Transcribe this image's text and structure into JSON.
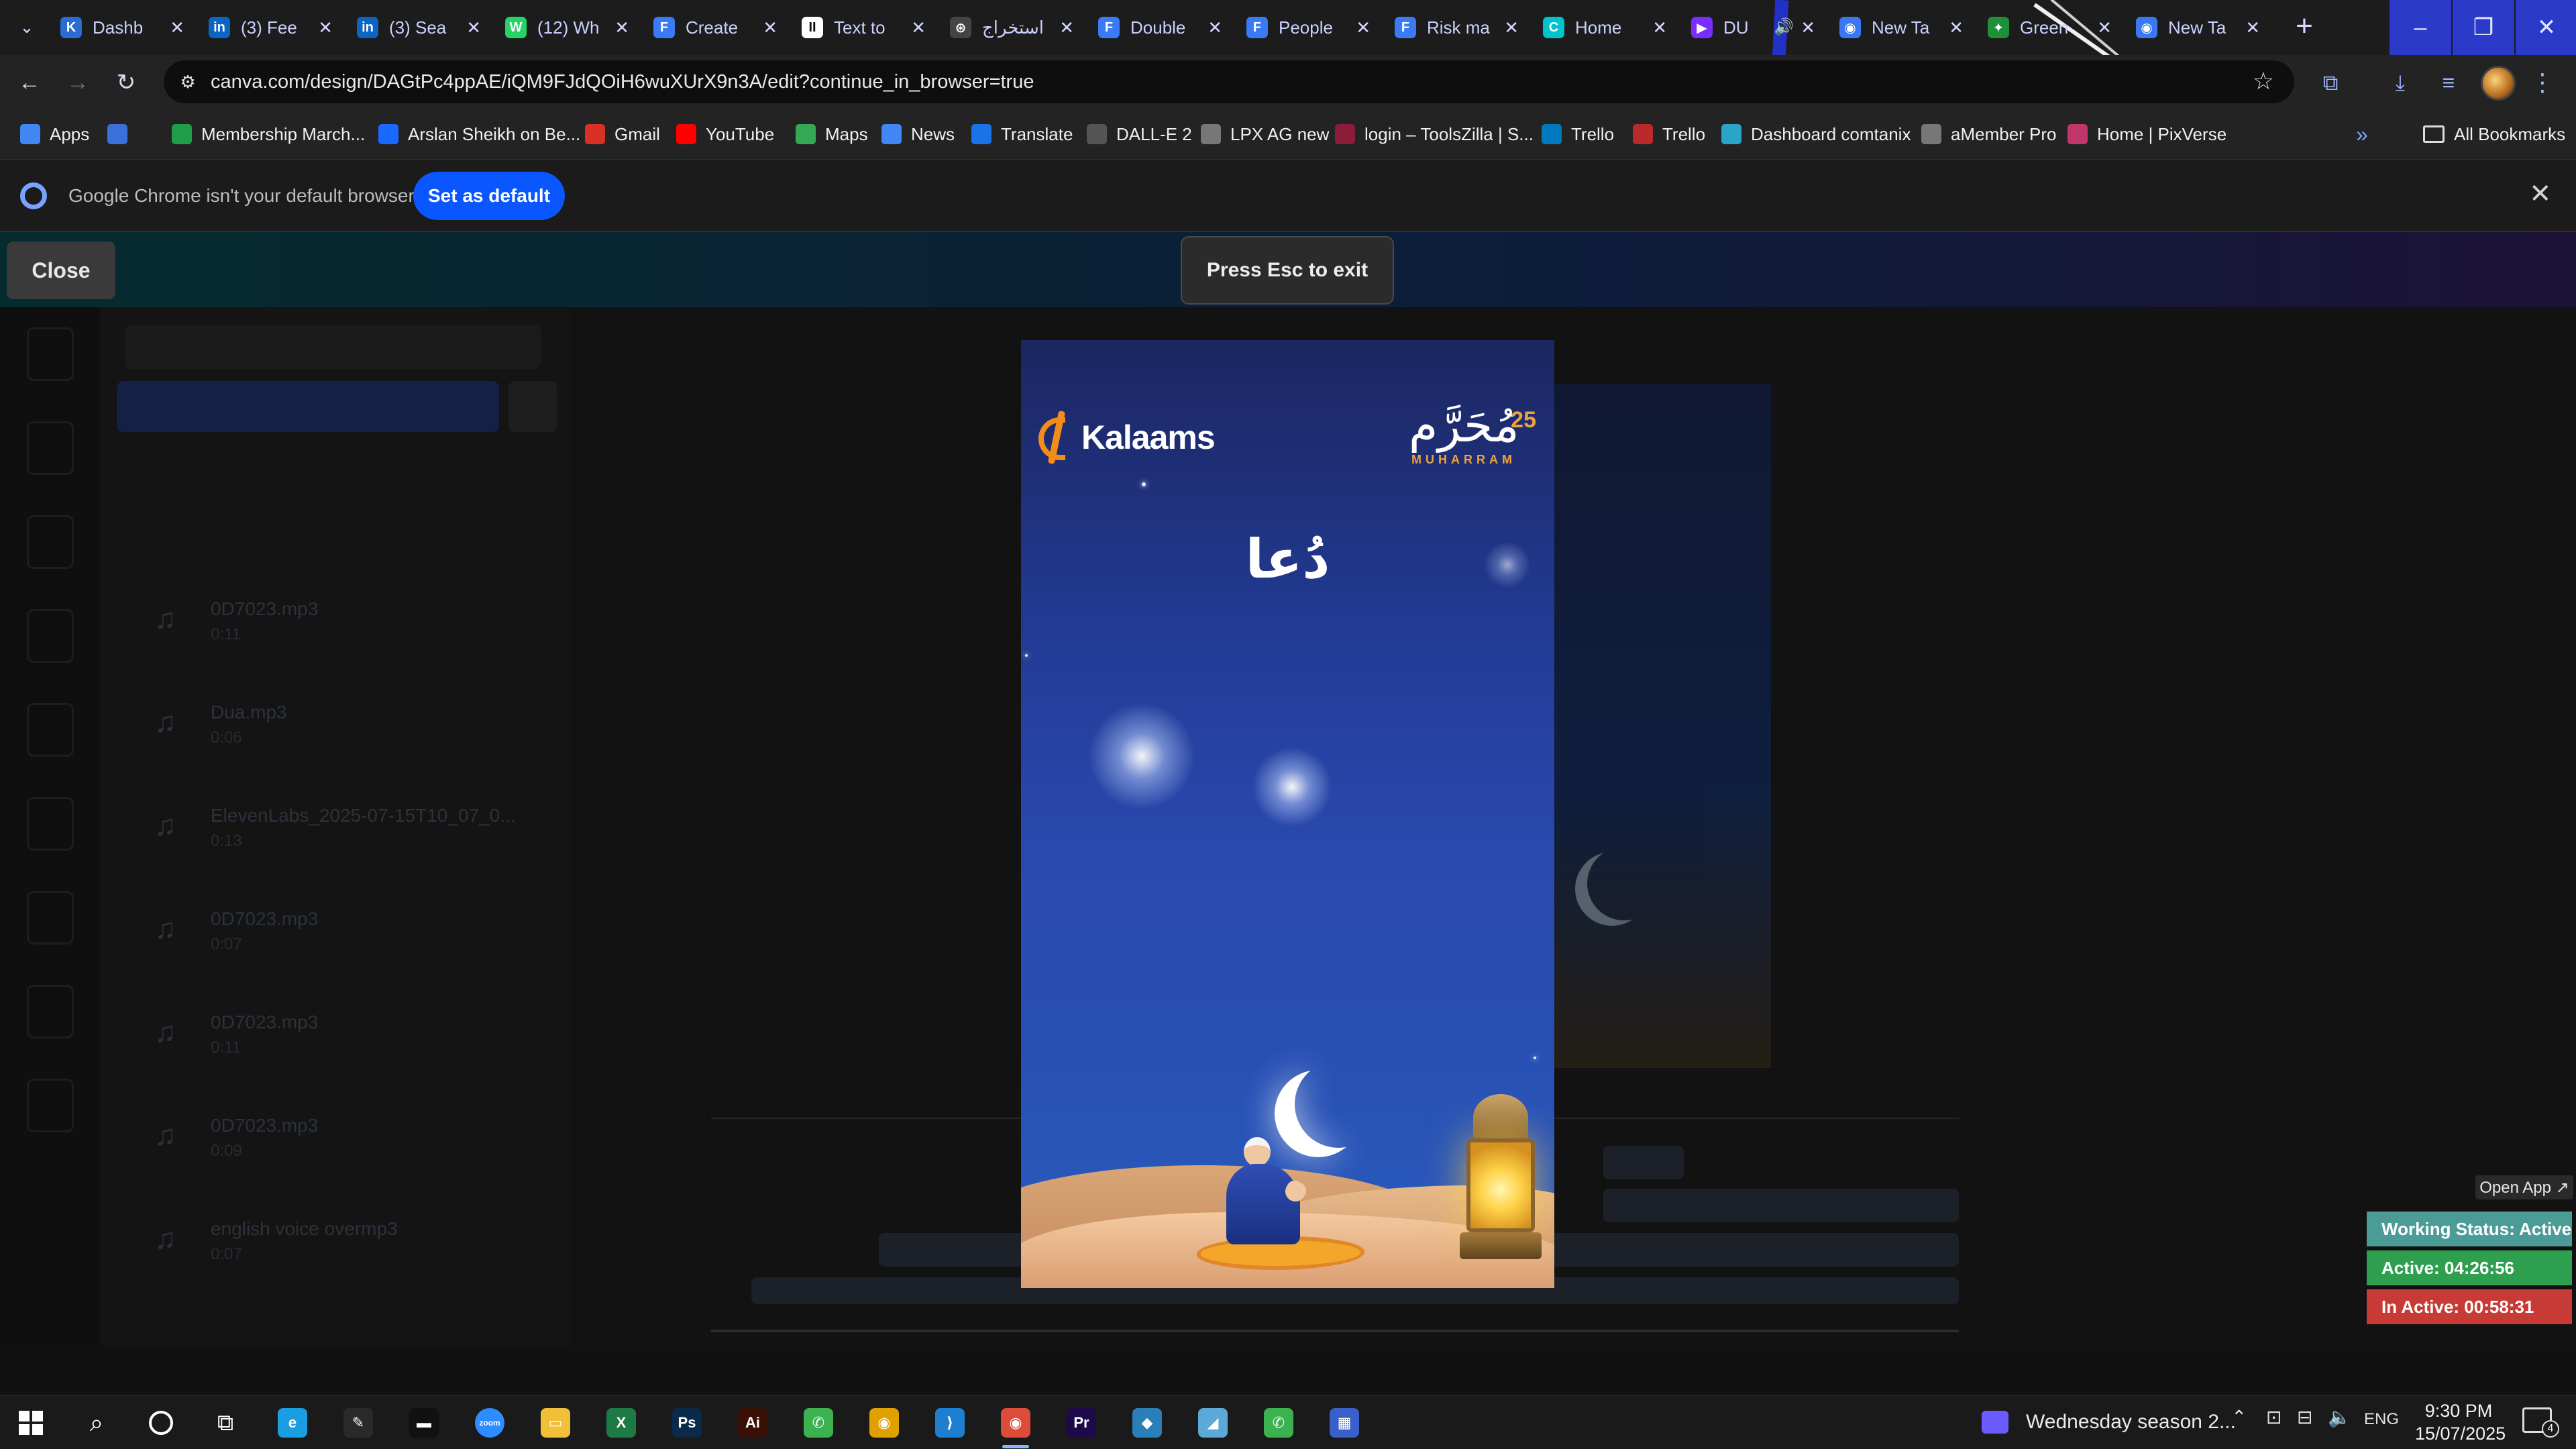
{
  "browser": {
    "tabs": [
      {
        "title": "Dashb",
        "icon": "kalaams-favicon",
        "color": "#2a6bd4",
        "glyph": "K"
      },
      {
        "title": "(3) Fee",
        "icon": "linkedin-icon",
        "color": "#0a66c2",
        "glyph": "in"
      },
      {
        "title": "(3) Sea",
        "icon": "linkedin-icon",
        "color": "#0a66c2",
        "glyph": "in"
      },
      {
        "title": "(12) Wh",
        "icon": "whatsapp-icon",
        "color": "#25d366",
        "glyph": "W"
      },
      {
        "title": "Create",
        "icon": "forms-icon",
        "color": "#3a7bf5",
        "glyph": "F"
      },
      {
        "title": "Text to",
        "icon": "textto-icon",
        "color": "#ffffff",
        "glyph": "II"
      },
      {
        "title": "استخراج",
        "icon": "openai-icon",
        "color": "#444444",
        "glyph": "⊛"
      },
      {
        "title": "Double",
        "icon": "forms-icon",
        "color": "#3a7bf5",
        "glyph": "F"
      },
      {
        "title": "People",
        "icon": "forms-icon",
        "color": "#3a7bf5",
        "glyph": "F"
      },
      {
        "title": "Risk ma",
        "icon": "forms-icon",
        "color": "#3a7bf5",
        "glyph": "F"
      },
      {
        "title": "Home",
        "icon": "canva-icon",
        "color": "#00c4cc",
        "glyph": "C"
      },
      {
        "title": "DU",
        "icon": "video-icon",
        "color": "#7b2cff",
        "glyph": "▶",
        "audio": true
      },
      {
        "title": "New Ta",
        "icon": "chrome-icon",
        "color": "#3a78f2",
        "glyph": "◉"
      },
      {
        "title": "Green",
        "icon": "palm-icon",
        "color": "#1f8f3a",
        "glyph": "✦"
      },
      {
        "title": "New Ta",
        "icon": "chrome-icon",
        "color": "#3a78f2",
        "glyph": "◉"
      }
    ],
    "url": "canva.com/design/DAGtPc4ppAE/iQM9FJdQOiH6wuXUrX9n3A/edit?continue_in_browser=true",
    "bookmarks": [
      {
        "label": "Apps",
        "icon": "apps-grid-icon",
        "color": "#4285f4"
      },
      {
        "label": "",
        "icon": "grid-icon",
        "color": "#3b6fd9"
      },
      {
        "label": "Membership March...",
        "icon": "green-bookmark-icon",
        "color": "#1e9e4a"
      },
      {
        "label": "Arslan Sheikh on Be...",
        "icon": "behance-icon",
        "color": "#1769ff"
      },
      {
        "label": "Gmail",
        "icon": "gmail-icon",
        "color": "#d93025"
      },
      {
        "label": "YouTube",
        "icon": "youtube-icon",
        "color": "#ff0000"
      },
      {
        "label": "Maps",
        "icon": "maps-icon",
        "color": "#34a853"
      },
      {
        "label": "News",
        "icon": "news-icon",
        "color": "#4285f4"
      },
      {
        "label": "Translate",
        "icon": "translate-icon",
        "color": "#1a73e8"
      },
      {
        "label": "DALL-E 2",
        "icon": "openai-icon",
        "color": "#555555"
      },
      {
        "label": "LPX AG new",
        "icon": "globe-icon",
        "color": "#777777"
      },
      {
        "label": "login – ToolsZilla | S...",
        "icon": "toolszilla-icon",
        "color": "#8b1d3a"
      },
      {
        "label": "Trello",
        "icon": "trello-icon",
        "color": "#0079bf"
      },
      {
        "label": "Trello",
        "icon": "trello-icon",
        "color": "#bb2a2a"
      },
      {
        "label": "Dashboard comtanix",
        "icon": "comtanix-icon",
        "color": "#2aa5c7"
      },
      {
        "label": "aMember Pro",
        "icon": "globe-icon",
        "color": "#777777"
      },
      {
        "label": "Home | PixVerse",
        "icon": "pixverse-icon",
        "color": "#c1366a"
      }
    ],
    "all_bookmarks": "All Bookmarks"
  },
  "infobar": {
    "message": "Google Chrome isn't your default browser",
    "button": "Set as default"
  },
  "editor": {
    "close": "Close",
    "esc_toast": "Press Esc to exit",
    "audio_items": [
      {
        "name": "0D7023.mp3",
        "duration": "0:11"
      },
      {
        "name": "Dua.mp3",
        "duration": "0:06"
      },
      {
        "name": "ElevenLabs_2025-07-15T10_07_0...",
        "duration": "0:13"
      },
      {
        "name": "0D7023.mp3",
        "duration": "0:07"
      },
      {
        "name": "0D7023.mp3",
        "duration": "0:11"
      },
      {
        "name": "0D7023.mp3",
        "duration": "0:09"
      },
      {
        "name": "english voice overmp3",
        "duration": "0:07"
      }
    ]
  },
  "design": {
    "brand": "Kalaams",
    "muharram_arabic": "مُحَرَّم",
    "muharram_number": "25",
    "muharram_english": "MUHARRAM",
    "title_arabic": "دُعا"
  },
  "tracker": {
    "open_app": "Open App ↗",
    "status": "Working Status: Active",
    "active": "Active: 04:26:56",
    "inactive": "In Active: 00:58:31"
  },
  "taskbar": {
    "apps": [
      {
        "icon": "edge-icon",
        "color": "#1b9de2",
        "glyph": "e"
      },
      {
        "icon": "pen-icon",
        "color": "#2a2a2a",
        "glyph": "✎"
      },
      {
        "icon": "terminal-icon",
        "color": "#111111",
        "glyph": "▬"
      },
      {
        "icon": "zoom-icon",
        "color": "#2d8cff",
        "glyph": "zoom"
      },
      {
        "icon": "file-explorer-icon",
        "color": "#f2c037",
        "glyph": "▭"
      },
      {
        "icon": "excel-icon",
        "color": "#1d7a45",
        "glyph": "X"
      },
      {
        "icon": "photoshop-icon",
        "color": "#0b2a4a",
        "glyph": "Ps"
      },
      {
        "icon": "illustrator-icon",
        "color": "#3a0f05",
        "glyph": "Ai"
      },
      {
        "icon": "phone-link-icon",
        "color": "#3bb24f",
        "glyph": "✆"
      },
      {
        "icon": "chrome-icon",
        "color": "#e0a000",
        "glyph": "◉"
      },
      {
        "icon": "vscode-icon",
        "color": "#1e7fd0",
        "glyph": "⟩"
      },
      {
        "icon": "chrome-profile-icon",
        "color": "#dd4b39",
        "glyph": "◉"
      },
      {
        "icon": "premiere-icon",
        "color": "#1e0a4a",
        "glyph": "Pr"
      },
      {
        "icon": "app-diamond-icon",
        "color": "#2a7fb8",
        "glyph": "◆"
      },
      {
        "icon": "app-blue-icon",
        "color": "#5aa9d6",
        "glyph": "◢"
      },
      {
        "icon": "phone-link-icon",
        "color": "#3bb24f",
        "glyph": "✆"
      },
      {
        "icon": "calculator-icon",
        "color": "#3a5fc8",
        "glyph": "▦"
      }
    ],
    "notification": "Wednesday season 2...",
    "language": "ENG",
    "time": "9:30 PM",
    "date": "15/07/2025",
    "notif_count": "4"
  }
}
